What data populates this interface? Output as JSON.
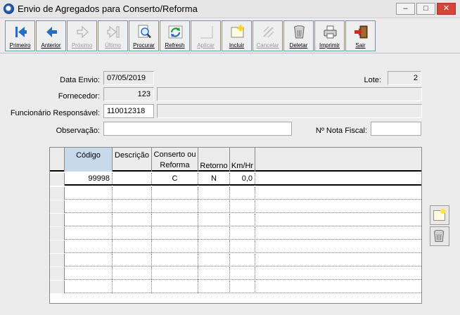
{
  "window": {
    "title": "Envio de Agregados para Conserto/Reforma",
    "min_glyph": "–",
    "max_glyph": "□",
    "close_glyph": "✕"
  },
  "toolbar": {
    "buttons": [
      {
        "label": "Primeiro",
        "icon": "first-record-icon",
        "enabled": true
      },
      {
        "label": "Anterior",
        "icon": "previous-record-icon",
        "enabled": true
      },
      {
        "label": "Próximo",
        "icon": "next-record-icon",
        "enabled": false
      },
      {
        "label": "Último",
        "icon": "last-record-icon",
        "enabled": false
      },
      {
        "label": "Procurar",
        "icon": "search-icon",
        "enabled": true
      },
      {
        "label": "Refresh",
        "icon": "refresh-icon",
        "enabled": true
      },
      {
        "label": "Aplicar",
        "icon": "apply-icon",
        "enabled": false
      },
      {
        "label": "Incluir",
        "icon": "new-record-icon",
        "enabled": true
      },
      {
        "label": "Cancelar",
        "icon": "cancel-icon",
        "enabled": false
      },
      {
        "label": "Deletar",
        "icon": "trash-icon",
        "enabled": true
      },
      {
        "label": "Imprimir",
        "icon": "printer-icon",
        "enabled": true
      },
      {
        "label": "Sair",
        "icon": "exit-icon",
        "enabled": true
      }
    ]
  },
  "form": {
    "data_envio_label": "Data Envio:",
    "data_envio_value": "07/05/2019",
    "lote_label": "Lote:",
    "lote_value": "2",
    "fornecedor_label": "Fornecedor:",
    "fornecedor_code": "123",
    "fornecedor_name": "",
    "funcionario_label": "Funcionário Responsável:",
    "funcionario_code": "110012318",
    "funcionario_name": "",
    "observacao_label": "Observação:",
    "observacao_value": "",
    "nota_fiscal_label": "Nº Nota Fiscal:",
    "nota_fiscal_value": ""
  },
  "grid": {
    "columns": [
      "Código",
      "Descrição",
      "Conserto ou\nReforma",
      "Retorno",
      "Km/Hr"
    ],
    "rows": [
      {
        "codigo": "99998",
        "descricao": "",
        "tipo": "C",
        "retorno": "N",
        "kmhr": "0,0"
      }
    ],
    "empty_rows": 8
  },
  "colors": {
    "toolbar_border": "#5aa4a4",
    "header_highlight": "#c9d9ec",
    "close_red": "#d4463a"
  }
}
